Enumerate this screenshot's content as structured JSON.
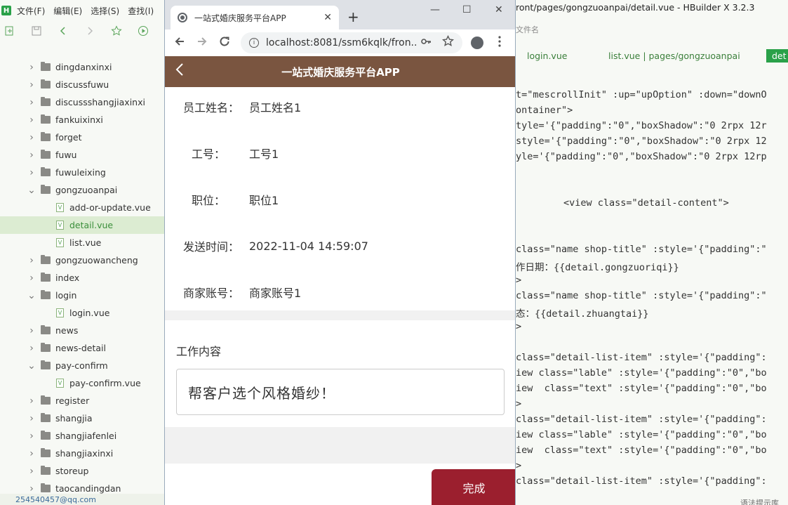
{
  "hbuilder": {
    "menu": [
      "文件(F)",
      "编辑(E)",
      "选择(S)",
      "查找(I)"
    ],
    "logo": "H",
    "window_title": "ront/pages/gongzuoanpai/detail.vue - HBuilder X 3.2.3",
    "sub_label": "文件名",
    "tabs": [
      "login.vue",
      "list.vue | pages/gongzuoanpai",
      "det"
    ],
    "tree": [
      {
        "label": "dingdanxinxi",
        "type": "folder",
        "expanded": false
      },
      {
        "label": "discussfuwu",
        "type": "folder",
        "expanded": false
      },
      {
        "label": "discussshangjiaxinxi",
        "type": "folder",
        "expanded": false
      },
      {
        "label": "fankuixinxi",
        "type": "folder",
        "expanded": false
      },
      {
        "label": "forget",
        "type": "folder",
        "expanded": false
      },
      {
        "label": "fuwu",
        "type": "folder",
        "expanded": false
      },
      {
        "label": "fuwuleixing",
        "type": "folder",
        "expanded": false
      },
      {
        "label": "gongzuoanpai",
        "type": "folder",
        "expanded": true
      },
      {
        "label": "add-or-update.vue",
        "type": "file"
      },
      {
        "label": "detail.vue",
        "type": "file",
        "selected": true
      },
      {
        "label": "list.vue",
        "type": "file"
      },
      {
        "label": "gongzuowancheng",
        "type": "folder",
        "expanded": false
      },
      {
        "label": "index",
        "type": "folder",
        "expanded": false
      },
      {
        "label": "login",
        "type": "folder",
        "expanded": true
      },
      {
        "label": "login.vue",
        "type": "file"
      },
      {
        "label": "news",
        "type": "folder",
        "expanded": false
      },
      {
        "label": "news-detail",
        "type": "folder",
        "expanded": false
      },
      {
        "label": "pay-confirm",
        "type": "folder",
        "expanded": true
      },
      {
        "label": "pay-confirm.vue",
        "type": "file"
      },
      {
        "label": "register",
        "type": "folder",
        "expanded": false
      },
      {
        "label": "shangjia",
        "type": "folder",
        "expanded": false
      },
      {
        "label": "shangjiafenlei",
        "type": "folder",
        "expanded": false
      },
      {
        "label": "shangjiaxinxi",
        "type": "folder",
        "expanded": false
      },
      {
        "label": "storeup",
        "type": "folder",
        "expanded": false
      },
      {
        "label": "taocandingdan",
        "type": "folder",
        "expanded": false
      }
    ],
    "status_left": "254540457@qq.com",
    "status_right": "语法提示库",
    "code_lines": [
      "t=\"mescrollInit\" :up=\"upOption\" :down=\"downO",
      "ontainer\">",
      "tyle='{\"padding\":\"0\",\"boxShadow\":\"0 2rpx 12r",
      "style='{\"padding\":\"0\",\"boxShadow\":\"0 2rpx 12",
      "yle='{\"padding\":\"0\",\"boxShadow\":\"0 2rpx 12rp",
      "<view class=\"detail-content\">",
      "class=\"name shop-title\" :style='{\"padding\":\"",
      "作日期：{{detail.gongzuoriqi}}",
      ">",
      "class=\"name shop-title\" :style='{\"padding\":\"",
      "态：{{detail.zhuangtai}}",
      ">",
      "class=\"detail-list-item\" :style='{\"padding\":",
      "iew class=\"lable\" :style='{\"padding\":\"0\",\"bo",
      "iew  class=\"text\" :style='{\"padding\":\"0\",\"bo",
      ">",
      "class=\"detail-list-item\" :style='{\"padding\":",
      "iew class=\"lable\" :style='{\"padding\":\"0\",\"bo",
      "iew  class=\"text\" :style='{\"padding\":\"0\",\"bo",
      ">",
      "class=\"detail-list-item\" :style='{\"padding\":"
    ]
  },
  "browser": {
    "tab_title": "一站式婚庆服务平台APP",
    "url": "localhost:8081/ssm6kqlk/fron...",
    "new_tab_symbol": "+",
    "close_symbol": "✕",
    "minimize_symbol": "—",
    "maximize_symbol": "☐",
    "window_close_symbol": "✕"
  },
  "app": {
    "header_title": "一站式婚庆服务平台APP",
    "fields": [
      {
        "label": "员工姓名：",
        "value": "员工姓名1"
      },
      {
        "label": "工号：",
        "value": "工号1"
      },
      {
        "label": "职位：",
        "value": "职位1"
      },
      {
        "label": "发送时间：",
        "value": "2022-11-04 14:59:07"
      },
      {
        "label": "商家账号：",
        "value": "商家账号1"
      }
    ],
    "section_title": "工作内容",
    "content": "帮客户选个风格婚纱！",
    "done_label": "完成"
  },
  "colors": {
    "header_brown": "#7a5540",
    "done_button": "#9b1f2e",
    "hbuilder_green": "#2aa149"
  }
}
